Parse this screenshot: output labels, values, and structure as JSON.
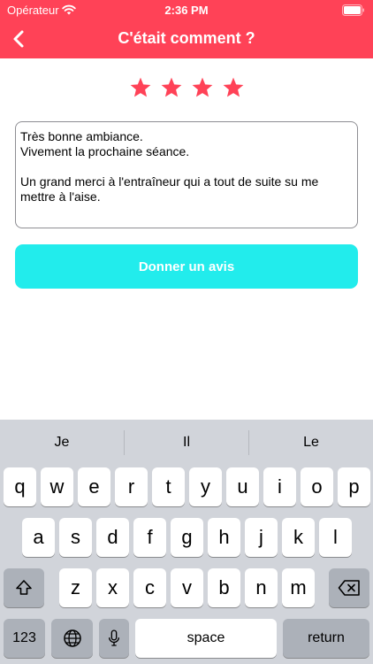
{
  "status": {
    "carrier": "Opérateur",
    "time": "2:36 PM"
  },
  "nav": {
    "title": "C'était comment ?",
    "back_icon": "chevron-left-icon"
  },
  "rating": {
    "value": 4,
    "max": 4,
    "color": "#ff4257"
  },
  "review": {
    "text": "Très bonne ambiance.\nVivement la prochaine séance.\n\nUn grand merci à l'entraîneur qui a tout de suite su me mettre à l'aise."
  },
  "submit": {
    "label": "Donner un avis",
    "color": "#22ecec"
  },
  "keyboard": {
    "suggestions": [
      "Je",
      "Il",
      "Le"
    ],
    "row1": [
      "q",
      "w",
      "e",
      "r",
      "t",
      "y",
      "u",
      "i",
      "o",
      "p"
    ],
    "row2": [
      "a",
      "s",
      "d",
      "f",
      "g",
      "h",
      "j",
      "k",
      "l"
    ],
    "row3": [
      "z",
      "x",
      "c",
      "v",
      "b",
      "n",
      "m"
    ],
    "numbers_label": "123",
    "space_label": "space",
    "return_label": "return"
  },
  "colors": {
    "brand": "#ff4257",
    "accent": "#22ecec",
    "keyboard_bg": "#d1d4da"
  }
}
